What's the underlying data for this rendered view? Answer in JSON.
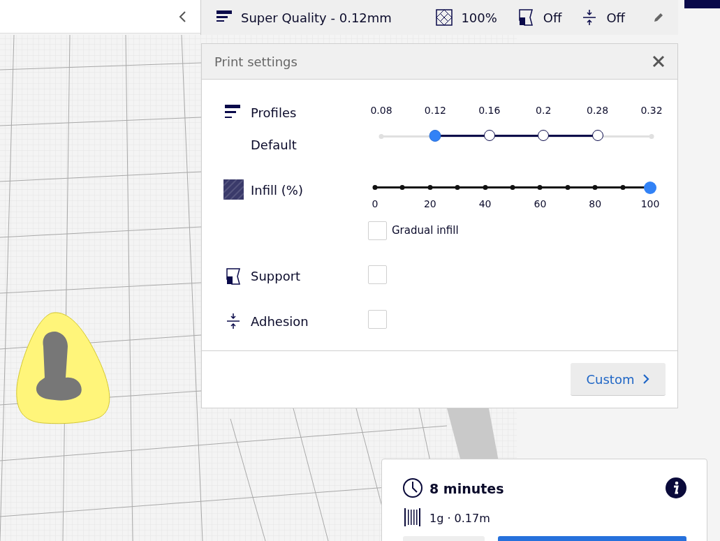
{
  "top_bar": {
    "profile": "Super Quality - 0.12mm",
    "infill": "100%",
    "support": "Off",
    "adhesion": "Off"
  },
  "print_settings": {
    "title": "Print settings",
    "profiles": {
      "label": "Profiles",
      "sublabel": "Default",
      "points": [
        {
          "label": "0.08",
          "kind": "unavailable",
          "selected": false
        },
        {
          "label": "0.12",
          "kind": "available",
          "selected": true
        },
        {
          "label": "0.16",
          "kind": "available",
          "selected": false
        },
        {
          "label": "0.2",
          "kind": "available",
          "selected": false
        },
        {
          "label": "0.28",
          "kind": "available",
          "selected": false
        },
        {
          "label": "0.32",
          "kind": "unavailable",
          "selected": false
        }
      ]
    },
    "infill": {
      "label": "Infill (%)",
      "level": 1,
      "ticks": [
        "0",
        "20",
        "40",
        "60",
        "80",
        "100"
      ]
    },
    "gradual_infill": {
      "label": "Gradual infill",
      "checked": false
    },
    "support": {
      "label": "Support",
      "checked": false
    },
    "adhesion": {
      "label": "Adhesion",
      "checked": false
    },
    "custom_button": "Custom"
  },
  "estimate": {
    "time": "8 minutes",
    "material": "1g · 0.17m"
  }
}
